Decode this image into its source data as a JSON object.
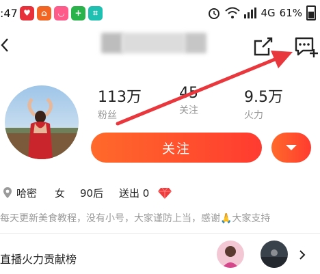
{
  "status_bar": {
    "time": ":47",
    "network": "4G",
    "battery": "61%"
  },
  "profile": {
    "stats": [
      {
        "value": "113万",
        "label": "粉丝"
      },
      {
        "value": "45",
        "label": "关注"
      },
      {
        "value": "9.5万",
        "label": "火力"
      }
    ],
    "follow_label": "关注",
    "location": "哈密",
    "gender": "女",
    "age_group": "90后",
    "gifts_sent": "送出 0",
    "description": "每天更新美食教程，没有小号，大家谨防上当，感谢🙏大家支持"
  },
  "ranking": {
    "title": "直播火力贡献榜"
  },
  "colors": {
    "accent": "#ff4d2e",
    "annotation_arrow": "#e8383d"
  }
}
